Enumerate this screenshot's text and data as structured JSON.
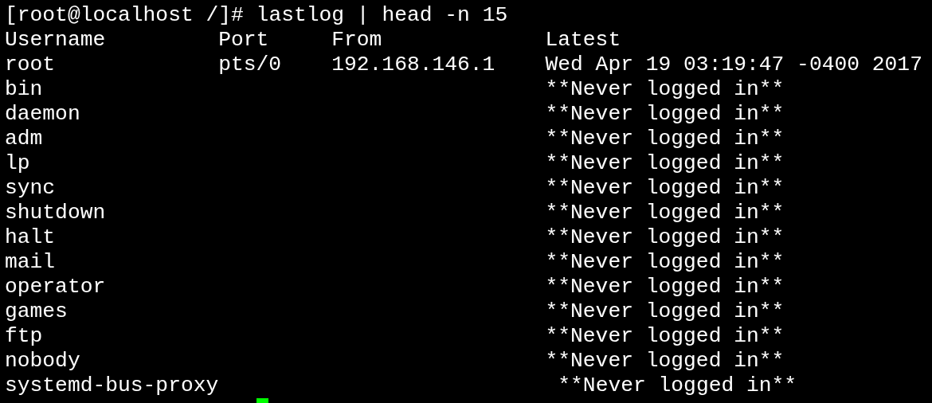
{
  "terminal": {
    "command_line": "[root@localhost /]# lastlog | head -n 15",
    "header": {
      "username": "Username",
      "port": "Port",
      "from": "From",
      "latest": "Latest"
    },
    "rows": [
      {
        "username": "root",
        "port": "pts/0",
        "from": "192.168.146.1",
        "latest": "Wed Apr 19 03:19:47 -0400 2017"
      },
      {
        "username": "bin",
        "latest": "**Never logged in**"
      },
      {
        "username": "daemon",
        "latest": "**Never logged in**"
      },
      {
        "username": "adm",
        "latest": "**Never logged in**"
      },
      {
        "username": "lp",
        "latest": "**Never logged in**"
      },
      {
        "username": "sync",
        "latest": "**Never logged in**"
      },
      {
        "username": "shutdown",
        "latest": "**Never logged in**"
      },
      {
        "username": "halt",
        "latest": "**Never logged in**"
      },
      {
        "username": "mail",
        "latest": "**Never logged in**"
      },
      {
        "username": "operator",
        "latest": "**Never logged in**"
      },
      {
        "username": "games",
        "latest": "**Never logged in**"
      },
      {
        "username": "ftp",
        "latest": "**Never logged in**"
      },
      {
        "username": "nobody",
        "latest": "**Never logged in**"
      },
      {
        "username": "systemd-bus-proxy",
        "latest": "**Never logged in**"
      }
    ]
  }
}
